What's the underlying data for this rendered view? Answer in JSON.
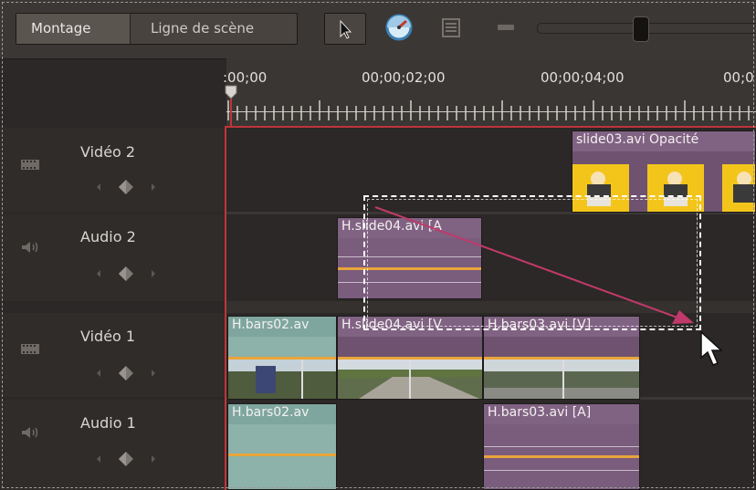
{
  "toolbar": {
    "tabs": [
      {
        "label": "Montage",
        "active": true
      },
      {
        "label": "Ligne de scène",
        "active": false
      }
    ],
    "tools": [
      "selection-arrow-icon",
      "time-stretch-icon",
      "properties-icon"
    ],
    "zoom_level_fraction": 0.43
  },
  "ruler": {
    "timecodes": [
      ":00;00",
      "00;00;02;00",
      "00;00;04;00",
      "00;0"
    ]
  },
  "tracks": [
    {
      "name": "Vidéo 2",
      "type": "video"
    },
    {
      "name": "Audio 2",
      "type": "audio"
    },
    {
      "name": "Vidéo 1",
      "type": "video"
    },
    {
      "name": "Audio 1",
      "type": "audio"
    }
  ],
  "clips": {
    "video2_slide03": "slide03.avi  Opacité",
    "audio2_slide04": "H.slide04.avi [A",
    "video1_bars02": "H.bars02.av",
    "video1_slide04": "H.slide04.avi [V",
    "video1_bars03": "H.bars03.avi [V]",
    "audio1_bars02": "H.bars02.av",
    "audio1_bars03": "H.bars03.avi [A]"
  },
  "colors": {
    "work_area_border": "#c0353a",
    "rubber_band": "#e9a53a",
    "drag_arrow": "#c0396a",
    "clip_purple": "#7a5c7d",
    "clip_teal": "#8cb2a9"
  }
}
